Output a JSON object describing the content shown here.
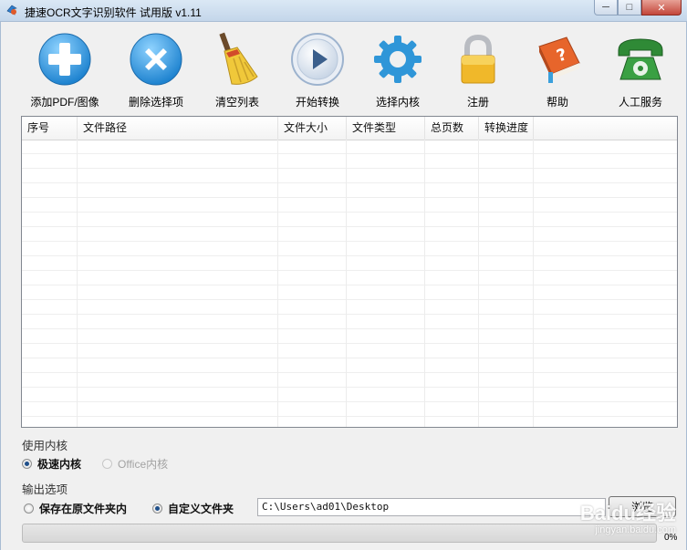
{
  "window": {
    "title": "捷速OCR文字识别软件 试用版 v1.11",
    "minimize": "─",
    "maximize": "□",
    "close": "✕"
  },
  "toolbar": [
    {
      "label": "添加PDF/图像",
      "icon": "add-icon"
    },
    {
      "label": "删除选择项",
      "icon": "delete-icon"
    },
    {
      "label": "清空列表",
      "icon": "broom-icon"
    },
    {
      "label": "开始转换",
      "icon": "play-icon"
    },
    {
      "label": "选择内核",
      "icon": "gear-icon"
    },
    {
      "label": "注册",
      "icon": "lock-icon"
    },
    {
      "label": "帮助",
      "icon": "help-book-icon"
    },
    {
      "label": "人工服务",
      "icon": "telephone-icon"
    }
  ],
  "table": {
    "columns": [
      "序号",
      "文件路径",
      "文件大小",
      "文件类型",
      "总页数",
      "转换进度",
      ""
    ],
    "rows": []
  },
  "engine": {
    "section_label": "使用内核",
    "options": [
      {
        "label": "极速内核",
        "selected": true,
        "disabled": false
      },
      {
        "label": "Office内核",
        "selected": false,
        "disabled": true
      }
    ]
  },
  "output": {
    "section_label": "输出选项",
    "options": [
      {
        "label": "保存在原文件夹内",
        "selected": false
      },
      {
        "label": "自定义文件夹",
        "selected": true
      }
    ],
    "path_value": "C:\\Users\\ad01\\Desktop",
    "browse_label": "浏览"
  },
  "progress": {
    "value": 0,
    "text": "0%"
  },
  "watermark": {
    "brand": "Baidu经验",
    "url": "jingyan.baidu.com"
  },
  "colors": {
    "accent_blue": "#2f8fd6",
    "progress_green": "#3bb33b",
    "phone_green": "#3a8f3a",
    "lock_gold": "#f0b82a"
  }
}
